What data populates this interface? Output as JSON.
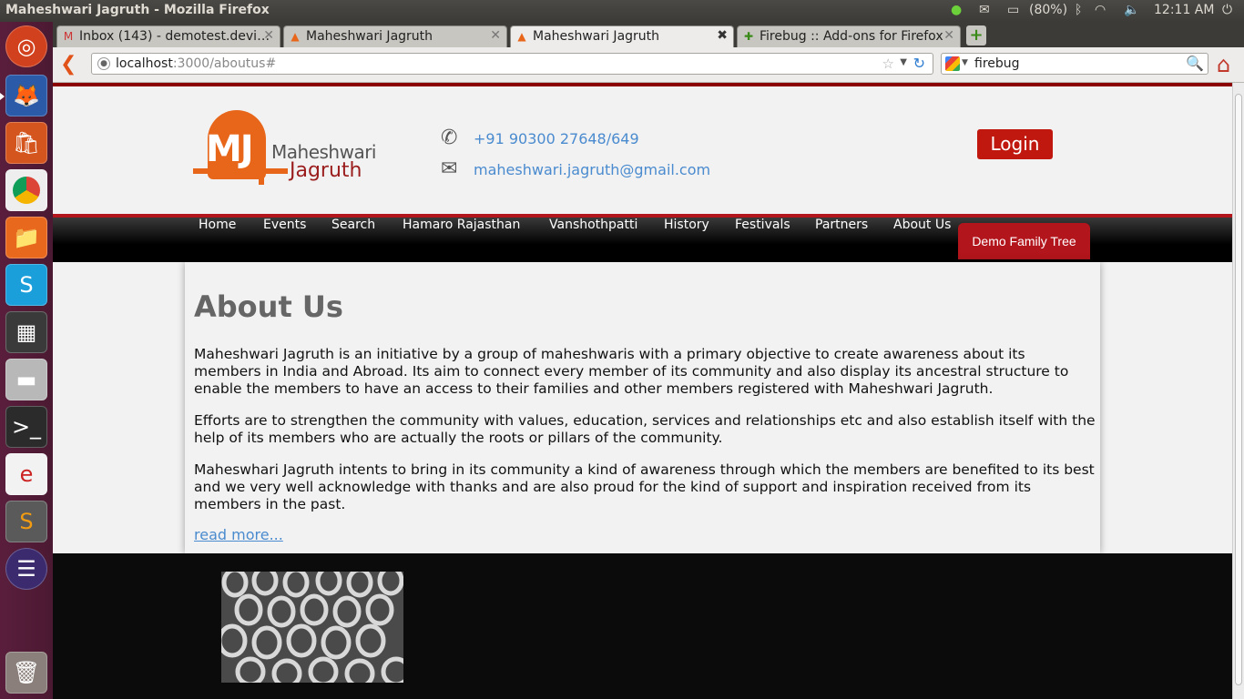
{
  "os": {
    "window_title": "Maheshwari Jagruth - Mozilla Firefox",
    "battery": "(80%)",
    "clock": "12:11 AM"
  },
  "browser": {
    "tabs": [
      {
        "label": "Inbox (143) - demotest.devi…",
        "icon": "gmail-icon"
      },
      {
        "label": "Maheshwari Jagruth",
        "icon": "site-favicon"
      },
      {
        "label": "Maheshwari Jagruth",
        "icon": "site-favicon"
      },
      {
        "label": "Firebug :: Add-ons for Firefox",
        "icon": "puzzle-icon"
      }
    ],
    "active_tab_index": 2,
    "url_host": "localhost",
    "url_rest": ":3000/aboutus#",
    "search_query": "firebug"
  },
  "site": {
    "logo": {
      "mark": "MJ",
      "line1": "Maheshwari",
      "line2": "Jagruth"
    },
    "phone": "+91 90300 27648/649",
    "email": "maheshwari.jagruth@gmail.com",
    "login_label": "Login",
    "nav": [
      "Home",
      "Events",
      "Search",
      "Hamaro Rajasthan",
      "Vanshothpatti",
      "History",
      "Festivals",
      "Partners",
      "About Us"
    ],
    "nav_highlight": "Demo Family Tree",
    "page_title": "About Us",
    "paragraphs": [
      "Maheshwari Jagruth is an initiative by a group of maheshwaris with a primary objective to create awareness about its members in India and Abroad. Its aim to connect every member of its community and also display its ancestral structure to enable the members to have an access to their families and other members registered with Maheshwari Jagruth.",
      "Efforts are to strengthen the community with values, education, services and relationships etc and also establish itself with the help of its members who are actually the roots or pillars of the community.",
      "Maheswhari Jagruth intents to bring in its community a kind of awareness through which the members are benefited to its best and we very well acknowledge with thanks and are also proud for the kind of support and inspiration received from its members in the past."
    ],
    "read_more": "read more..."
  },
  "colors": {
    "brand_red": "#b3151c",
    "logo_orange": "#e8661a",
    "link_blue": "#4a8bcf"
  }
}
